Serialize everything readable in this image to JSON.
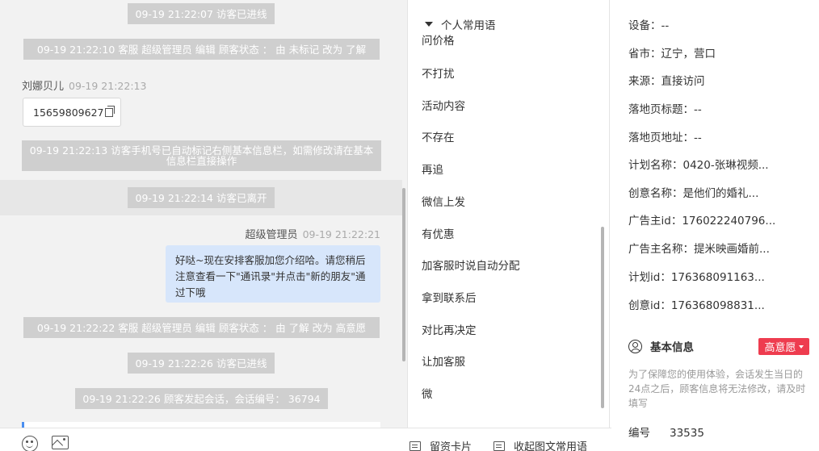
{
  "chat": {
    "sys1": "09-19 21:22:07 访客已进线",
    "sys2": "09-19 21:22:10 客服 超级管理员 编辑 顾客状态 ： 由 未标记 改为 了解",
    "visitor_name": "刘娜贝儿",
    "visitor_time": "09-19 21:22:13",
    "phone_number": "15659809627",
    "sys3": "09-19 21:22:13 访客手机号已自动标记右侧基本信息栏，如需修改请在基本信息栏直接操作",
    "sys4": "09-19 21:22:14 访客已离开",
    "agent_name": "超级管理员",
    "agent_time": "09-19 21:22:21",
    "agent_message": "好哒~现在安排客服加您介绍哈。请您稍后注意查看一下\"通讯录\"并点击\"新的朋友\"通过下哦",
    "sys5": "09-19 21:22:22 客服 超级管理员 编辑 顾客状态 ： 由 了解 改为 高意愿",
    "sys6": "09-19 21:22:26 访客已进线",
    "sys7": "09-19 21:22:26 顾客发起会话，会话编号： 36794"
  },
  "phrases": {
    "group_label": "个人常用语",
    "items": [
      "问价格",
      "不打扰",
      "活动内容",
      "不存在",
      "再追",
      "微信上发",
      "有优惠",
      "加客服时说自动分配",
      "拿到联系后",
      "对比再决定",
      "让加客服",
      "微"
    ]
  },
  "toolbar": {
    "lead_card_label": "留资卡片",
    "collapse_label": "收起图文常用语"
  },
  "info": {
    "rows": [
      {
        "label": "设备：",
        "value": "--"
      },
      {
        "label": "省市：",
        "value": "辽宁，营口"
      },
      {
        "label": "来源：",
        "value": "直接访问"
      },
      {
        "label": "落地页标题：",
        "value": "--"
      },
      {
        "label": "落地页地址：",
        "value": "--"
      },
      {
        "label": "计划名称：",
        "value": "0420-张琳视频..."
      },
      {
        "label": "创意名称：",
        "value": "是他们的婚礼..."
      },
      {
        "label": "广告主id：",
        "value": "176022240796..."
      },
      {
        "label": "广告主名称：",
        "value": "提米映画婚前..."
      },
      {
        "label": "计划id：",
        "value": "176368091163..."
      },
      {
        "label": "创意id：",
        "value": "176368098831..."
      }
    ],
    "section_title": "基本信息",
    "intent_badge": "高意愿",
    "notice": "为了保障您的使用体验，会话发生当日的24点之后，顾客信息将无法修改，请及时填写",
    "id_label": "编号",
    "id_value": "33535"
  },
  "colors": {
    "badge": "#ee3c4f",
    "bubble": "#d7e6fb",
    "system_message": "#cfcfcf",
    "chat_background": "#f2f2f2"
  }
}
